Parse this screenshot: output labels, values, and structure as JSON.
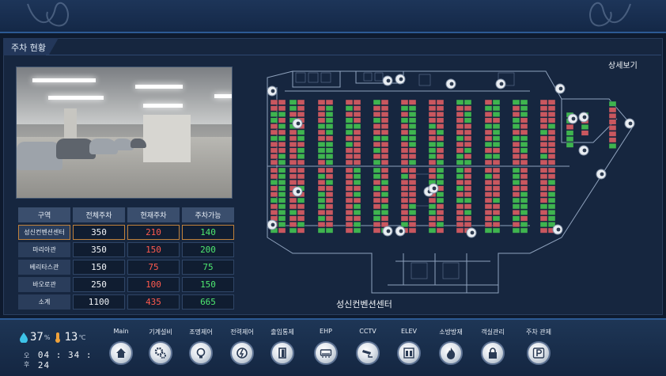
{
  "panel": {
    "title": "주차 현황"
  },
  "table": {
    "headers": [
      "구역",
      "전체주차",
      "현재주차",
      "주차가능"
    ],
    "rows": [
      {
        "name": "성신컨벤션센터",
        "total": "350",
        "current": "210",
        "available": "140"
      },
      {
        "name": "마리아관",
        "total": "350",
        "current": "150",
        "available": "200"
      },
      {
        "name": "베리타스관",
        "total": "150",
        "current": "75",
        "available": "75"
      },
      {
        "name": "바오로관",
        "total": "250",
        "current": "100",
        "available": "150"
      },
      {
        "name": "소계",
        "total": "1100",
        "current": "435",
        "available": "665"
      }
    ]
  },
  "map": {
    "detail_link": "상세보기",
    "caption": "성신컨벤션센터"
  },
  "env": {
    "humidity": "37",
    "humidity_unit": "%",
    "temperature": "13",
    "temperature_unit": "℃",
    "ampm": "오후",
    "time": "04 : 34 : 24"
  },
  "nav": {
    "items": [
      {
        "label": "Main",
        "icon": "home-icon"
      },
      {
        "label": "기계설비",
        "icon": "gears-icon"
      },
      {
        "label": "조명제어",
        "icon": "bulb-icon"
      },
      {
        "label": "전력제어",
        "icon": "power-icon"
      },
      {
        "label": "출입통제",
        "icon": "door-icon"
      },
      {
        "label": "EHP",
        "icon": "ac-unit-icon"
      },
      {
        "label": "CCTV",
        "icon": "cctv-icon"
      },
      {
        "label": "ELEV",
        "icon": "elevator-icon"
      },
      {
        "label": "소방방재",
        "icon": "fire-icon"
      },
      {
        "label": "객실관리",
        "icon": "room-lock-icon"
      },
      {
        "label": "주차 관제",
        "icon": "parking-icon"
      }
    ]
  },
  "colors": {
    "occupied": "#c9575f",
    "vacant": "#3fb44f",
    "value_red": "#ff5a4e",
    "value_green": "#4ee870"
  }
}
